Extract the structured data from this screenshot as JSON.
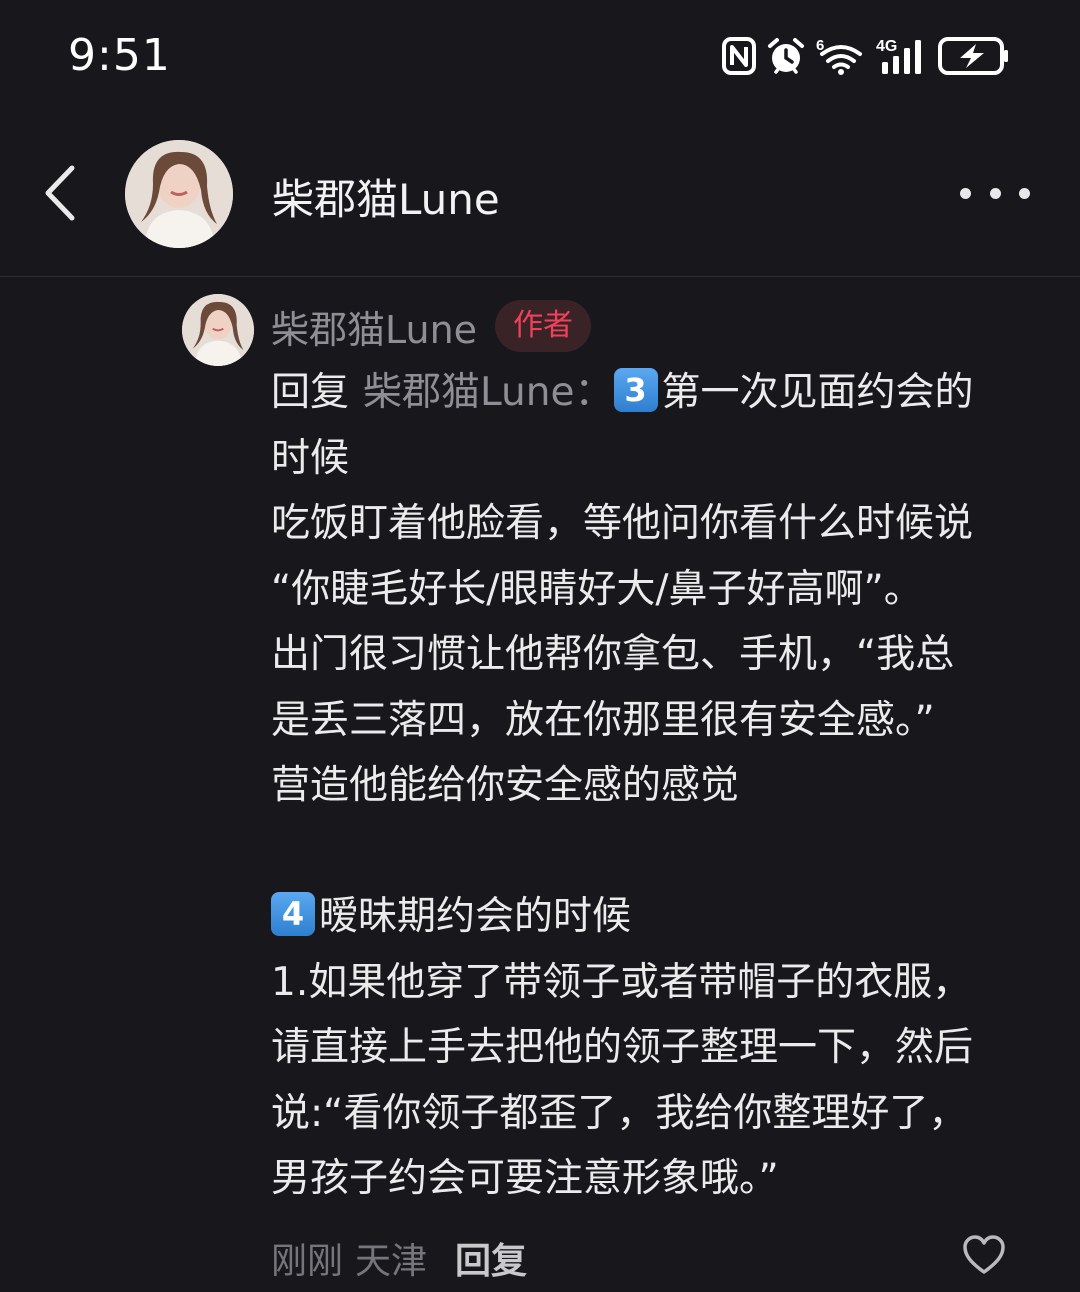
{
  "status_bar": {
    "time": "9:51",
    "icons": [
      "nfc-icon",
      "alarm-icon",
      "wifi-6-icon",
      "4g-signal-icon",
      "battery-charging-icon"
    ],
    "wifi_label": "6",
    "network_label": "4G"
  },
  "header": {
    "title": "柴郡猫Lune",
    "back_icon": "chevron-left-icon",
    "more_icon": "more-dots-icon"
  },
  "comment": {
    "author": "柴郡猫Lune",
    "badge": "作者",
    "reply_prefix": "回复",
    "reply_target": "柴郡猫Lune：",
    "keycap_3": "3",
    "keycap_4": "4",
    "lines": [
      "第一次见面约会的",
      "时候",
      "吃饭盯着他脸看，等他问你看什么时候说",
      "“你睫毛好长/眼睛好大/鼻子好高啊”。",
      "出门很习惯让他帮你拿包、手机，“我总",
      "是丢三落四，放在你那里很有安全感。”",
      "营造他能给你安全感的感觉",
      "暧昧期约会的时候",
      "1.如果他穿了带领子或者带帽子的衣服，",
      "请直接上手去把他的领子整理一下，然后",
      "说:“看你领子都歪了，我给你整理好了，",
      "男孩子约会可要注意形象哦。”"
    ],
    "footer": {
      "time": "刚刚",
      "location": "天津",
      "reply_label": "回复"
    }
  },
  "colors": {
    "background": "#17171c",
    "badge_text": "#f0415a",
    "badge_bg": "#3a2327",
    "muted_text": "#8e8e94",
    "keycap": "#3b8ee0"
  }
}
